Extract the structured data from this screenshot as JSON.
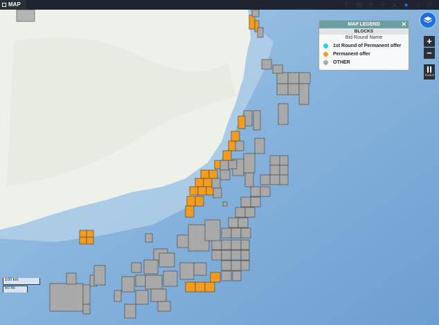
{
  "header": {
    "map_label": "MAP"
  },
  "toolbar": {
    "icons": [
      "refresh-icon",
      "map-icon",
      "zoom-in-icon",
      "zoom-extent-icon",
      "layers-stack-icon",
      "location-pin-icon",
      "download-icon",
      "settings-icon"
    ]
  },
  "legend": {
    "title": "MAP LEGEND",
    "close": "✕",
    "section": "BLOCKS",
    "field": "Bid Round Name",
    "items": [
      {
        "label": "1st Round of Permanent offer",
        "color": "#22d3e6"
      },
      {
        "label": "Permanent offer",
        "color": "#f39c1e"
      },
      {
        "label": "OTHER",
        "color": "#a9a9a9"
      }
    ]
  },
  "controls": {
    "zoom_in": "+",
    "zoom_out": "−",
    "tools_label": "TOOLS"
  },
  "scale": {
    "km": "100 km",
    "mi": "50 mi"
  },
  "colors": {
    "ocean": "#8fb9dd",
    "deep_ocean": "#6f9fd0",
    "land": "#eef0ea",
    "block_other": "#a9a9a9",
    "block_permanent": "#f39c1e",
    "block_first_round": "#22d3e6"
  }
}
